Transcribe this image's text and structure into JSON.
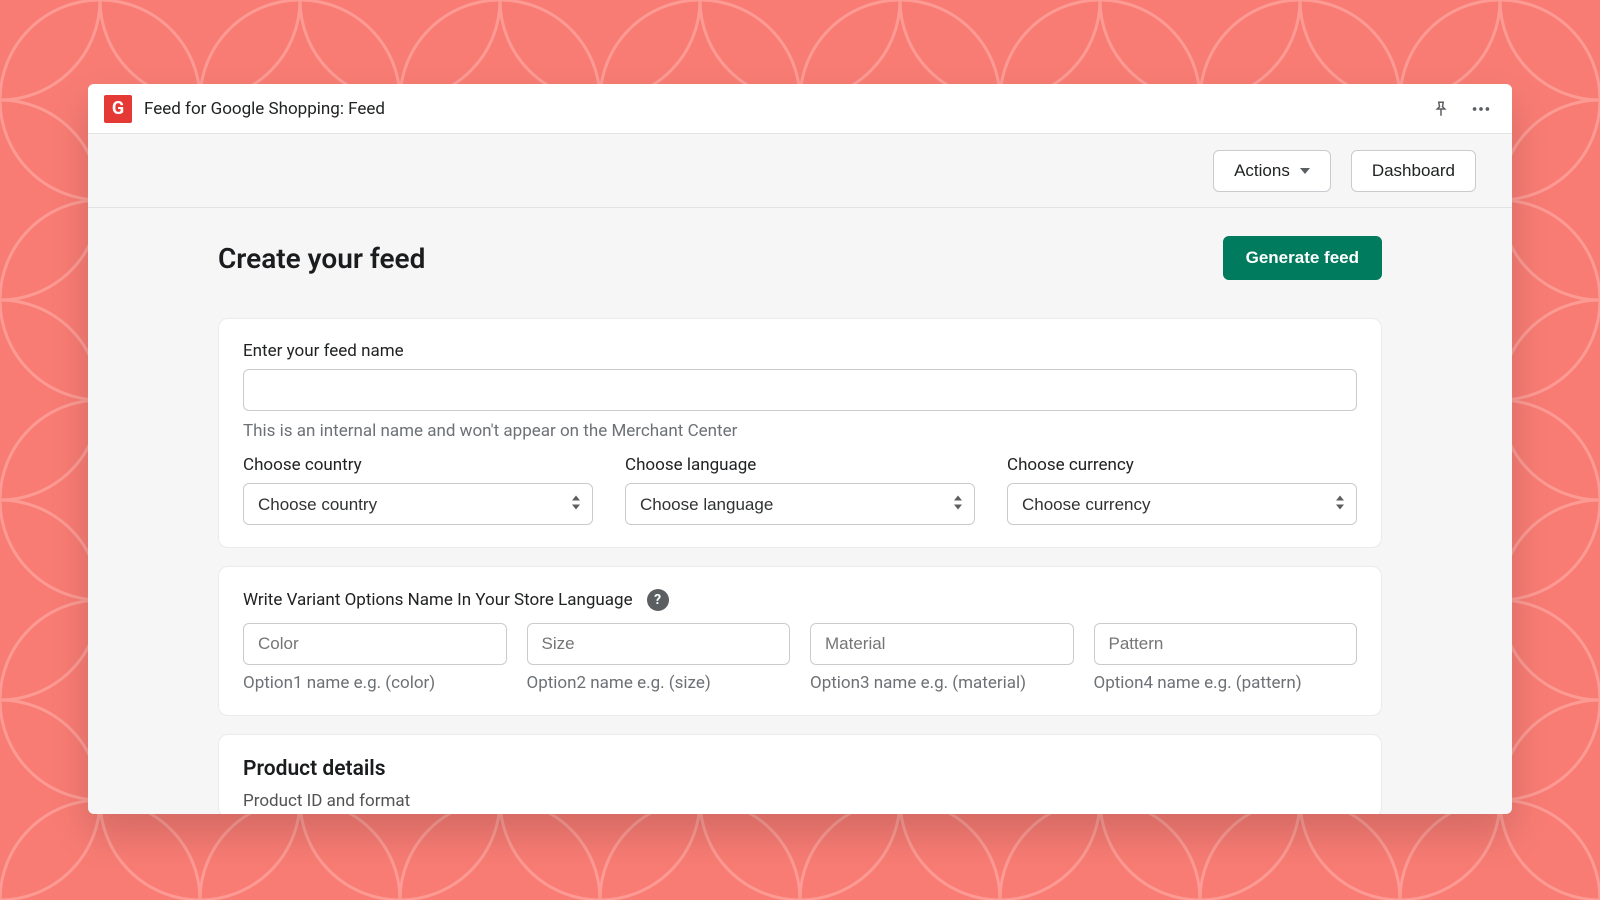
{
  "header": {
    "app_icon_letter": "G",
    "title": "Feed for Google Shopping: Feed"
  },
  "toolbar": {
    "actions_label": "Actions",
    "dashboard_label": "Dashboard"
  },
  "page": {
    "title": "Create your feed",
    "generate_label": "Generate feed"
  },
  "feed_card": {
    "name_label": "Enter your feed name",
    "name_value": "",
    "name_hint": "This is an internal name and won't appear on the Merchant Center",
    "country_label": "Choose country",
    "country_placeholder": "Choose country",
    "language_label": "Choose language",
    "language_placeholder": "Choose language",
    "currency_label": "Choose currency",
    "currency_placeholder": "Choose currency"
  },
  "variant_card": {
    "heading": "Write Variant Options Name In Your Store Language",
    "options": [
      {
        "placeholder": "Color",
        "hint": "Option1 name e.g. (color)"
      },
      {
        "placeholder": "Size",
        "hint": "Option2 name e.g. (size)"
      },
      {
        "placeholder": "Material",
        "hint": "Option3 name e.g. (material)"
      },
      {
        "placeholder": "Pattern",
        "hint": "Option4 name e.g. (pattern)"
      }
    ]
  },
  "product_card": {
    "title": "Product details",
    "sub": "Product ID and format"
  }
}
